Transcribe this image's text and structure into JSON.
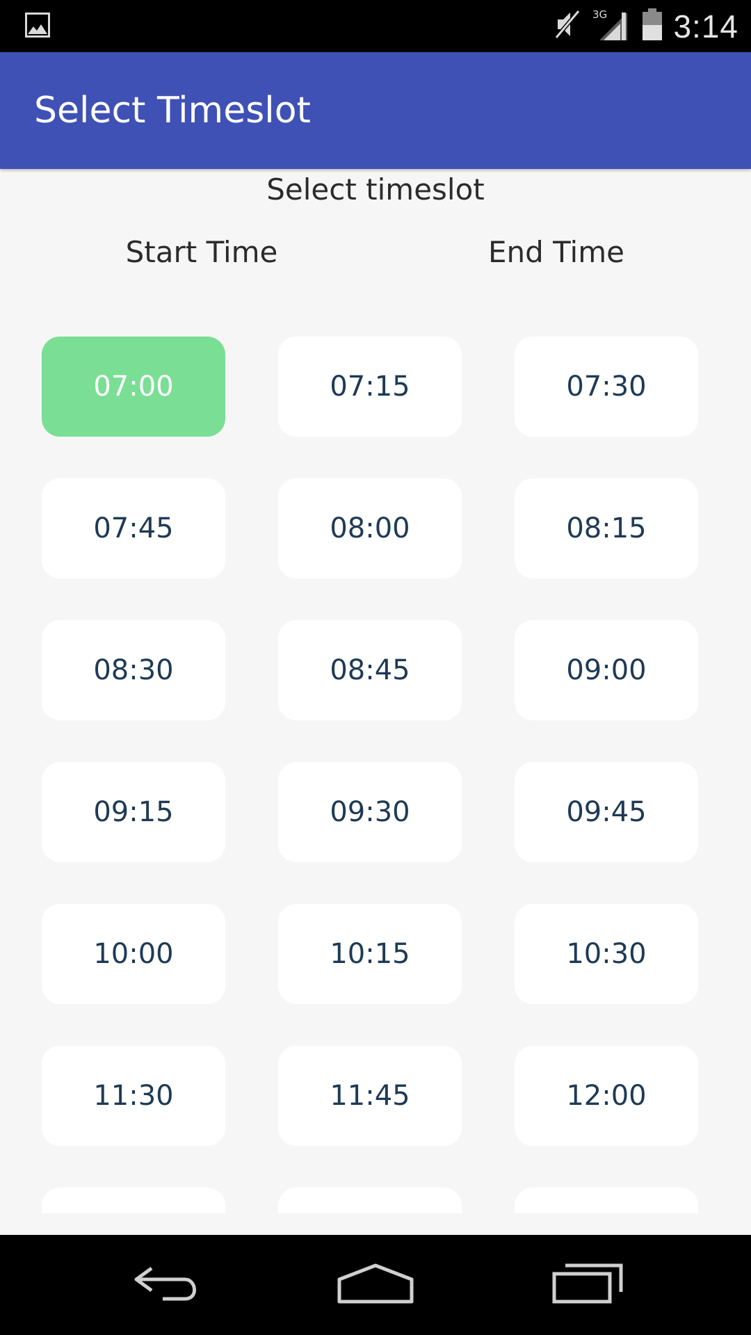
{
  "status_bar": {
    "time": "3:14",
    "network": "3G",
    "icons": [
      "image-notification-icon",
      "mute-icon",
      "signal-icon",
      "battery-icon"
    ]
  },
  "app_bar": {
    "title": "Select Timeslot",
    "color": "#3f51b5"
  },
  "content": {
    "subtitle": "Select timeslot",
    "start_header": "Start Time",
    "end_header": "End Time",
    "selected_color": "#7ade95",
    "slots": [
      {
        "label": "07:00",
        "selected": true
      },
      {
        "label": "07:15",
        "selected": false
      },
      {
        "label": "07:30",
        "selected": false
      },
      {
        "label": "07:45",
        "selected": false
      },
      {
        "label": "08:00",
        "selected": false
      },
      {
        "label": "08:15",
        "selected": false
      },
      {
        "label": "08:30",
        "selected": false
      },
      {
        "label": "08:45",
        "selected": false
      },
      {
        "label": "09:00",
        "selected": false
      },
      {
        "label": "09:15",
        "selected": false
      },
      {
        "label": "09:30",
        "selected": false
      },
      {
        "label": "09:45",
        "selected": false
      },
      {
        "label": "10:00",
        "selected": false
      },
      {
        "label": "10:15",
        "selected": false
      },
      {
        "label": "10:30",
        "selected": false
      },
      {
        "label": "11:30",
        "selected": false
      },
      {
        "label": "11:45",
        "selected": false
      },
      {
        "label": "12:00",
        "selected": false
      },
      {
        "label": "",
        "selected": false
      },
      {
        "label": "",
        "selected": false
      },
      {
        "label": "",
        "selected": false
      }
    ]
  },
  "nav_bar": {
    "icons": [
      "back-icon",
      "home-icon",
      "recents-icon"
    ]
  }
}
